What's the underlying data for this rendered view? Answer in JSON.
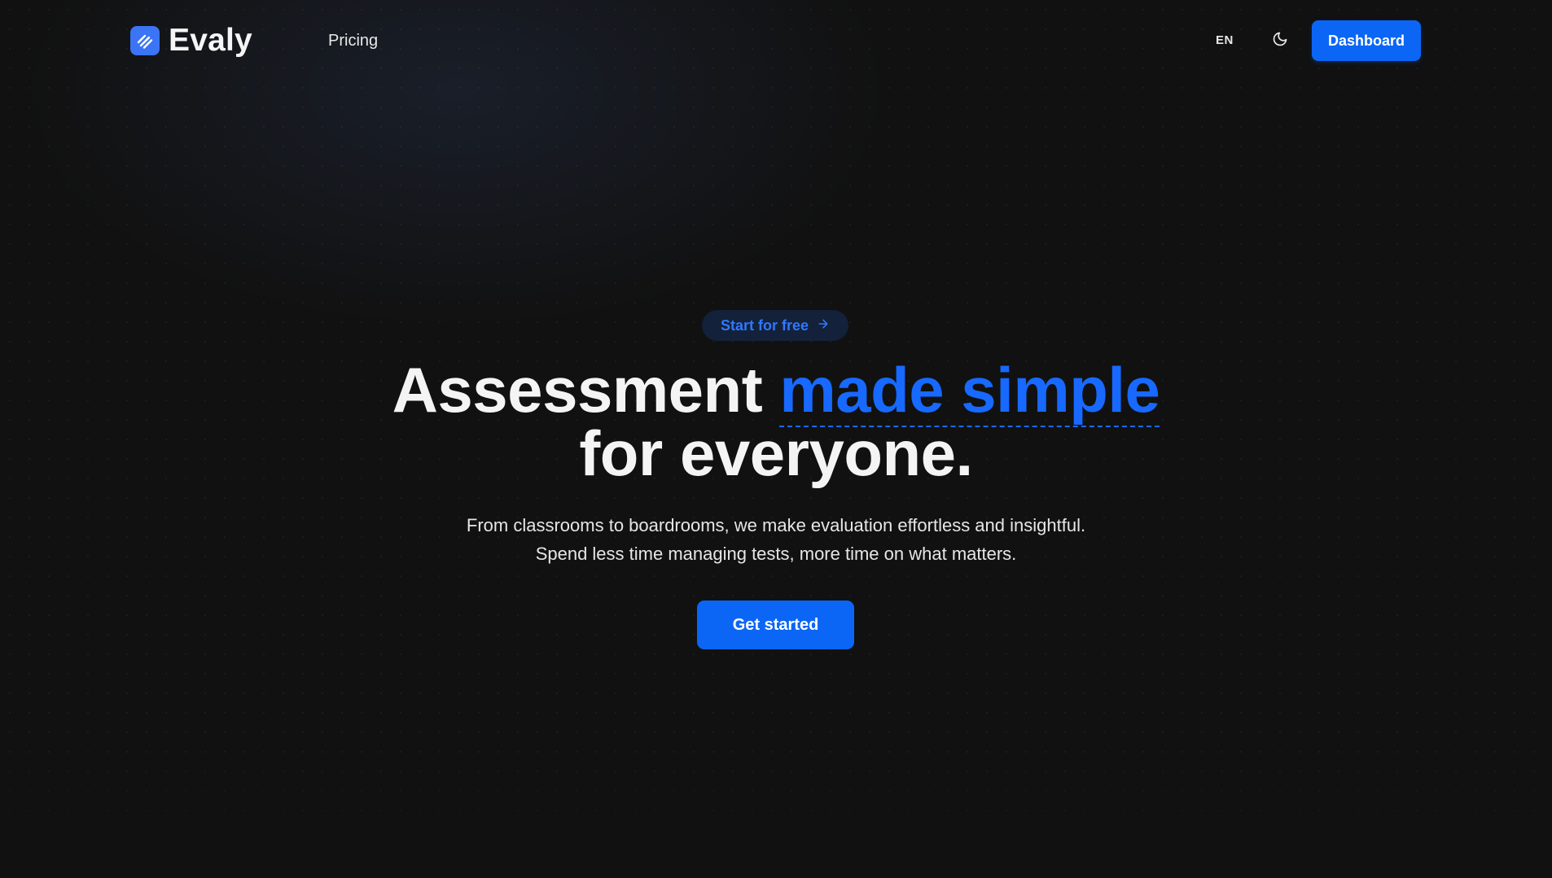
{
  "header": {
    "brand_name": "Evaly",
    "logo_icon": "evaly-logo-icon",
    "nav_pricing": "Pricing",
    "language": "EN",
    "theme_icon": "moon-icon",
    "dashboard_label": "Dashboard"
  },
  "hero": {
    "pill_label": "Start for free",
    "pill_icon": "arrow-right-icon",
    "headline_part1": "Assessment ",
    "headline_accent": "made simple",
    "headline_line2": "for everyone.",
    "subtext_line1": "From classrooms to boardrooms, we make evaluation effortless and insightful.",
    "subtext_line2": "Spend less time managing tests, more time on what matters.",
    "cta_label": "Get started"
  },
  "colors": {
    "background": "#111111",
    "accent": "#0b66f6",
    "accent_text": "#1769ff",
    "pill_background": "#13213a",
    "logo": "#3b74f5"
  }
}
